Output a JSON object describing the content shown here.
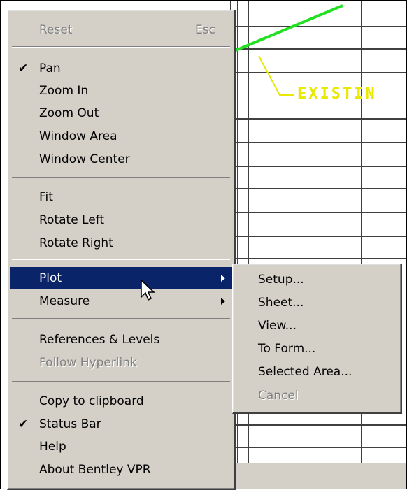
{
  "drawing": {
    "annotation_text": "EXISTIN",
    "colors": {
      "grid": "#404040",
      "road_line": "#22e022",
      "annotation": "#e8e800",
      "highlight": "#0a246a",
      "menu_bg": "#d4d0c8"
    }
  },
  "context_menu": {
    "items": [
      {
        "label": "Reset",
        "accel": "Esc",
        "enabled": false,
        "checked": false,
        "submenu": false
      },
      {
        "label": "Pan",
        "accel": "",
        "enabled": true,
        "checked": true,
        "submenu": false
      },
      {
        "label": "Zoom In",
        "accel": "",
        "enabled": true,
        "checked": false,
        "submenu": false
      },
      {
        "label": "Zoom Out",
        "accel": "",
        "enabled": true,
        "checked": false,
        "submenu": false
      },
      {
        "label": "Window Area",
        "accel": "",
        "enabled": true,
        "checked": false,
        "submenu": false
      },
      {
        "label": "Window Center",
        "accel": "",
        "enabled": true,
        "checked": false,
        "submenu": false
      },
      {
        "label": "Fit",
        "accel": "",
        "enabled": true,
        "checked": false,
        "submenu": false
      },
      {
        "label": "Rotate Left",
        "accel": "",
        "enabled": true,
        "checked": false,
        "submenu": false
      },
      {
        "label": "Rotate Right",
        "accel": "",
        "enabled": true,
        "checked": false,
        "submenu": false
      },
      {
        "label": "Plot",
        "accel": "",
        "enabled": true,
        "checked": false,
        "submenu": true,
        "highlighted": true
      },
      {
        "label": "Measure",
        "accel": "",
        "enabled": true,
        "checked": false,
        "submenu": true
      },
      {
        "label": "References & Levels",
        "accel": "",
        "enabled": true,
        "checked": false,
        "submenu": false
      },
      {
        "label": "Follow Hyperlink",
        "accel": "",
        "enabled": false,
        "checked": false,
        "submenu": false
      },
      {
        "label": "Copy to clipboard",
        "accel": "",
        "enabled": true,
        "checked": false,
        "submenu": false
      },
      {
        "label": "Status Bar",
        "accel": "",
        "enabled": true,
        "checked": true,
        "submenu": false
      },
      {
        "label": "Help",
        "accel": "",
        "enabled": true,
        "checked": false,
        "submenu": false
      },
      {
        "label": "About Bentley VPR",
        "accel": "",
        "enabled": true,
        "checked": false,
        "submenu": false
      }
    ],
    "check_glyph": "✔"
  },
  "plot_submenu": {
    "items": [
      {
        "label": "Setup...",
        "enabled": true
      },
      {
        "label": "Sheet...",
        "enabled": true
      },
      {
        "label": "View...",
        "enabled": true
      },
      {
        "label": "To Form...",
        "enabled": true
      },
      {
        "label": "Selected Area...",
        "enabled": true
      },
      {
        "label": "Cancel",
        "enabled": false
      }
    ]
  },
  "cursor_icon": "arrow-pointer-icon"
}
